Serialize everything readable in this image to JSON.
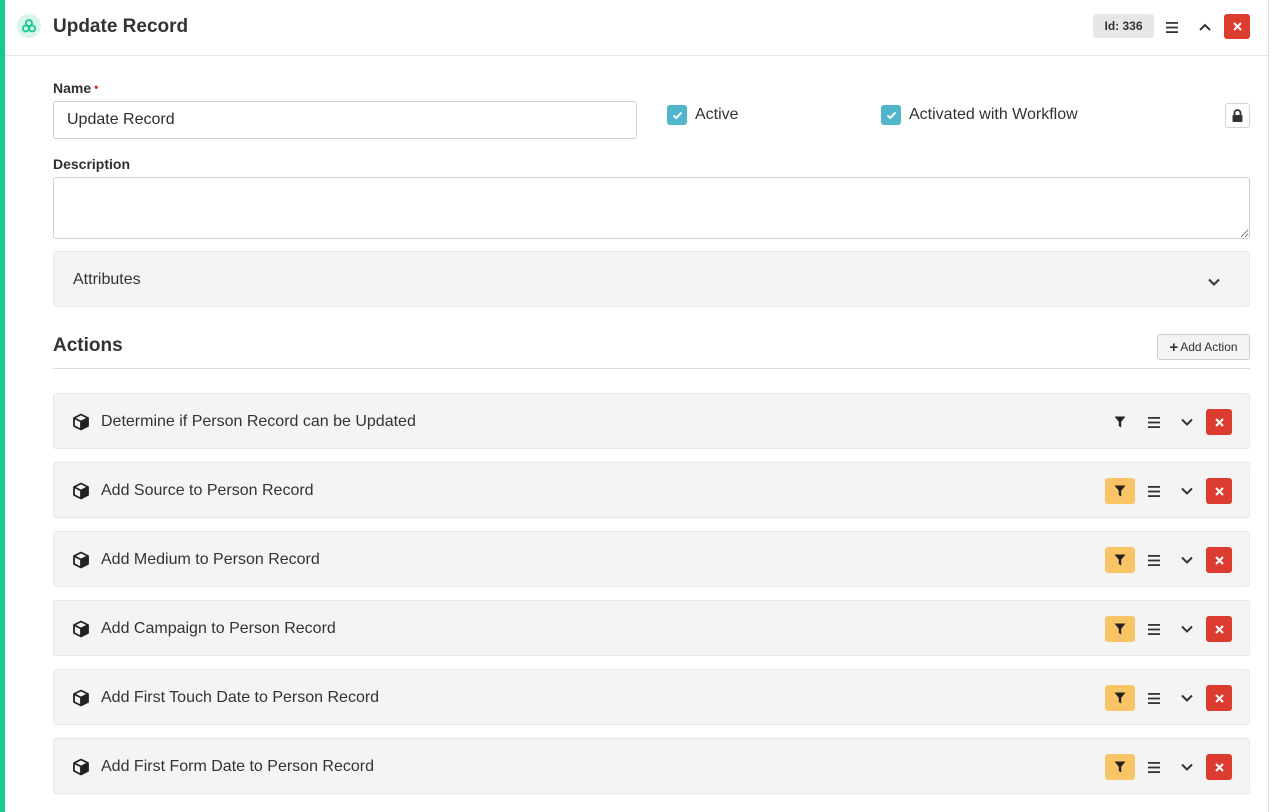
{
  "header": {
    "title": "Update Record",
    "id_label": "Id: 336"
  },
  "form": {
    "name_label": "Name",
    "required_mark": "•",
    "name_value": "Update Record",
    "active_label": "Active",
    "active_checked": true,
    "activated_workflow_label": "Activated with Workflow",
    "activated_workflow_checked": true,
    "description_label": "Description",
    "description_value": ""
  },
  "attributes": {
    "label": "Attributes"
  },
  "actions": {
    "title": "Actions",
    "add_label": "Add Action",
    "items": [
      {
        "label": "Determine if Person Record can be Updated",
        "filter_active": false
      },
      {
        "label": "Add Source to Person Record",
        "filter_active": true
      },
      {
        "label": "Add Medium to Person Record",
        "filter_active": true
      },
      {
        "label": "Add Campaign to Person Record",
        "filter_active": true
      },
      {
        "label": "Add First Touch Date to Person Record",
        "filter_active": true
      },
      {
        "label": "Add First Form Date to Person Record",
        "filter_active": true
      }
    ]
  },
  "colors": {
    "accent": "#16c98d",
    "danger": "#dc3b2f",
    "checkbox": "#4fb6cc",
    "filter_active": "#f9c465"
  },
  "icons": [
    "workflow-logo-icon",
    "list-icon",
    "chevron-up-icon",
    "close-icon",
    "lock-icon",
    "chevron-down-icon",
    "plus-icon",
    "cube-icon",
    "filter-icon"
  ]
}
